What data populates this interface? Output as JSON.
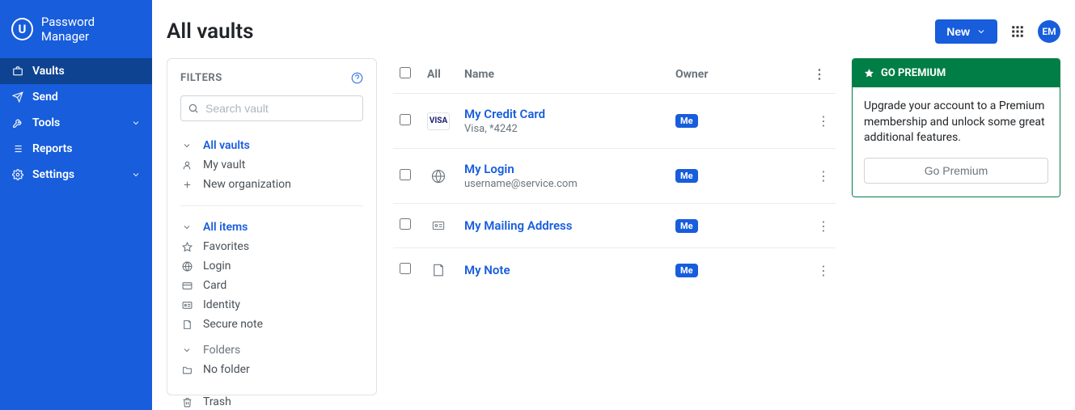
{
  "brand": {
    "logo_letter": "U",
    "title": "Password Manager"
  },
  "nav": {
    "items": [
      {
        "label": "Vaults",
        "active": true,
        "expandable": false
      },
      {
        "label": "Send",
        "active": false,
        "expandable": false
      },
      {
        "label": "Tools",
        "active": false,
        "expandable": true
      },
      {
        "label": "Reports",
        "active": false,
        "expandable": false
      },
      {
        "label": "Settings",
        "active": false,
        "expandable": true
      }
    ]
  },
  "page": {
    "title": "All vaults"
  },
  "topbar": {
    "new_label": "New",
    "avatar_initials": "EM"
  },
  "filters": {
    "title": "FILTERS",
    "search_placeholder": "Search vault",
    "vault_section": {
      "all_vaults": "All vaults",
      "my_vault": "My vault",
      "new_org": "New organization"
    },
    "item_section": {
      "all_items": "All items",
      "favorites": "Favorites",
      "login": "Login",
      "card": "Card",
      "identity": "Identity",
      "secure_note": "Secure note"
    },
    "folders_label": "Folders",
    "no_folder": "No folder",
    "trash": "Trash"
  },
  "table": {
    "header_all": "All",
    "header_name": "Name",
    "header_owner": "Owner",
    "rows": [
      {
        "title": "My Credit Card",
        "subtitle": "Visa, *4242",
        "icon": "visa",
        "owner": "Me"
      },
      {
        "title": "My Login",
        "subtitle": "username@service.com",
        "icon": "globe",
        "owner": "Me"
      },
      {
        "title": "My Mailing Address",
        "subtitle": "",
        "icon": "id-card",
        "owner": "Me"
      },
      {
        "title": "My Note",
        "subtitle": "",
        "icon": "note",
        "owner": "Me"
      }
    ]
  },
  "promo": {
    "header": "GO PREMIUM",
    "text": "Upgrade your account to a Premium membership and unlock some great additional features.",
    "button": "Go Premium"
  },
  "colors": {
    "primary": "#175DDC",
    "sidebar_active": "#0E4392",
    "premium_green": "#017E46"
  }
}
